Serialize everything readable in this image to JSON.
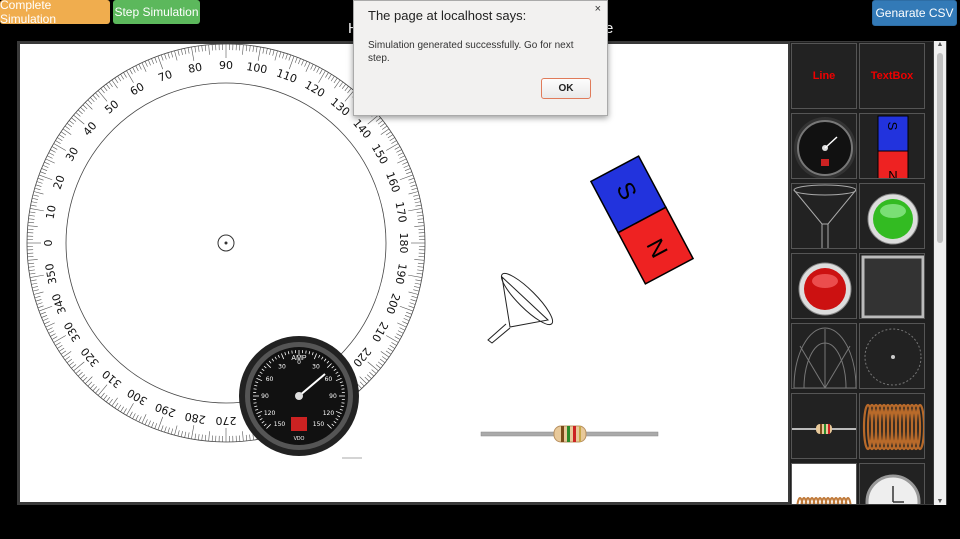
{
  "toolbar": {
    "complete_label": "Complete Simulation",
    "step_label": "Step Simulation",
    "csv_label": "Genarate CSV"
  },
  "page": {
    "title_left": "H",
    "title_right": "e"
  },
  "protractor": {
    "labels": [
      "0",
      "10",
      "20",
      "30",
      "40",
      "50",
      "60",
      "70",
      "80",
      "90",
      "100",
      "110",
      "120",
      "130",
      "140",
      "150",
      "160",
      "170",
      "180",
      "190",
      "200",
      "210",
      "220",
      "230",
      "240",
      "250",
      "260",
      "270",
      "280",
      "290",
      "300",
      "310",
      "320",
      "330",
      "340",
      "350"
    ]
  },
  "ammeter": {
    "title": "AMP",
    "brand": "VDO",
    "scale_labels": [
      "0",
      "30",
      "60",
      "90",
      "120",
      "150",
      "30",
      "60",
      "90",
      "120",
      "150"
    ]
  },
  "magnet": {
    "north": "N",
    "south": "S"
  },
  "palette": {
    "line_label": "Line",
    "textbox_label": "TextBox",
    "items": [
      "ammeter",
      "bar-magnet",
      "funnel",
      "green-button",
      "red-button",
      "square-frame",
      "protractor",
      "circle-dial",
      "resistor",
      "coil",
      "coil-2",
      "clock"
    ]
  },
  "dialog": {
    "title": "The page at localhost says:",
    "message": "Simulation generated successfully. Go for next step.",
    "ok_label": "OK",
    "close_glyph": "×"
  },
  "scrollbar": {
    "up": "▲",
    "down": "▼"
  }
}
